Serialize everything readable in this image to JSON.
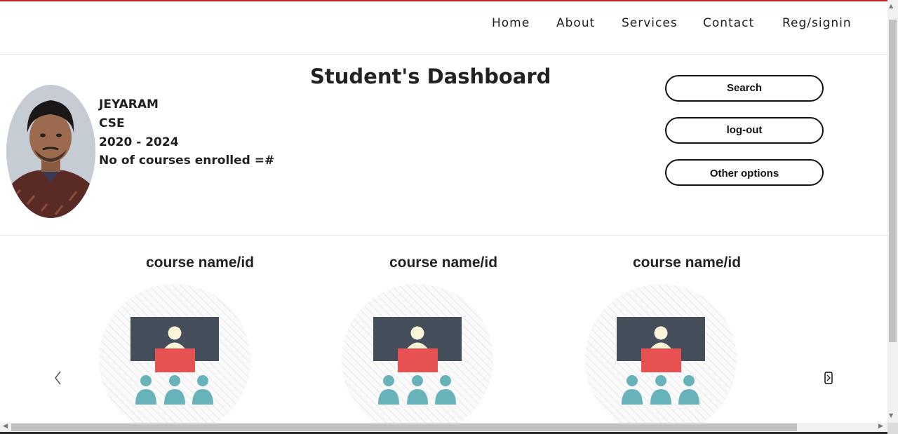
{
  "nav": {
    "items": [
      {
        "label": "Home"
      },
      {
        "label": "About"
      },
      {
        "label": "Services"
      },
      {
        "label": "Contact"
      },
      {
        "label": "Reg/signin"
      }
    ]
  },
  "dashboard": {
    "title": "Student's Dashboard"
  },
  "profile": {
    "name": "JEYARAM",
    "department": "CSE",
    "batch": "2020 - 2024",
    "courses_enrolled": "No of courses enrolled =#"
  },
  "actions": {
    "search_label": "Search",
    "logout_label": "log-out",
    "other_label": "Other options"
  },
  "courses": [
    {
      "title": "course name/id"
    },
    {
      "title": "course name/id"
    },
    {
      "title": "course name/id"
    }
  ],
  "icons": {
    "prev": "chevron-left-icon",
    "next": "chevron-right-icon",
    "course": "classroom-icon"
  },
  "colors": {
    "accent_topline": "#c0282d",
    "board": "#454f5b",
    "desk": "#e85151",
    "students": "#68b3b9"
  }
}
